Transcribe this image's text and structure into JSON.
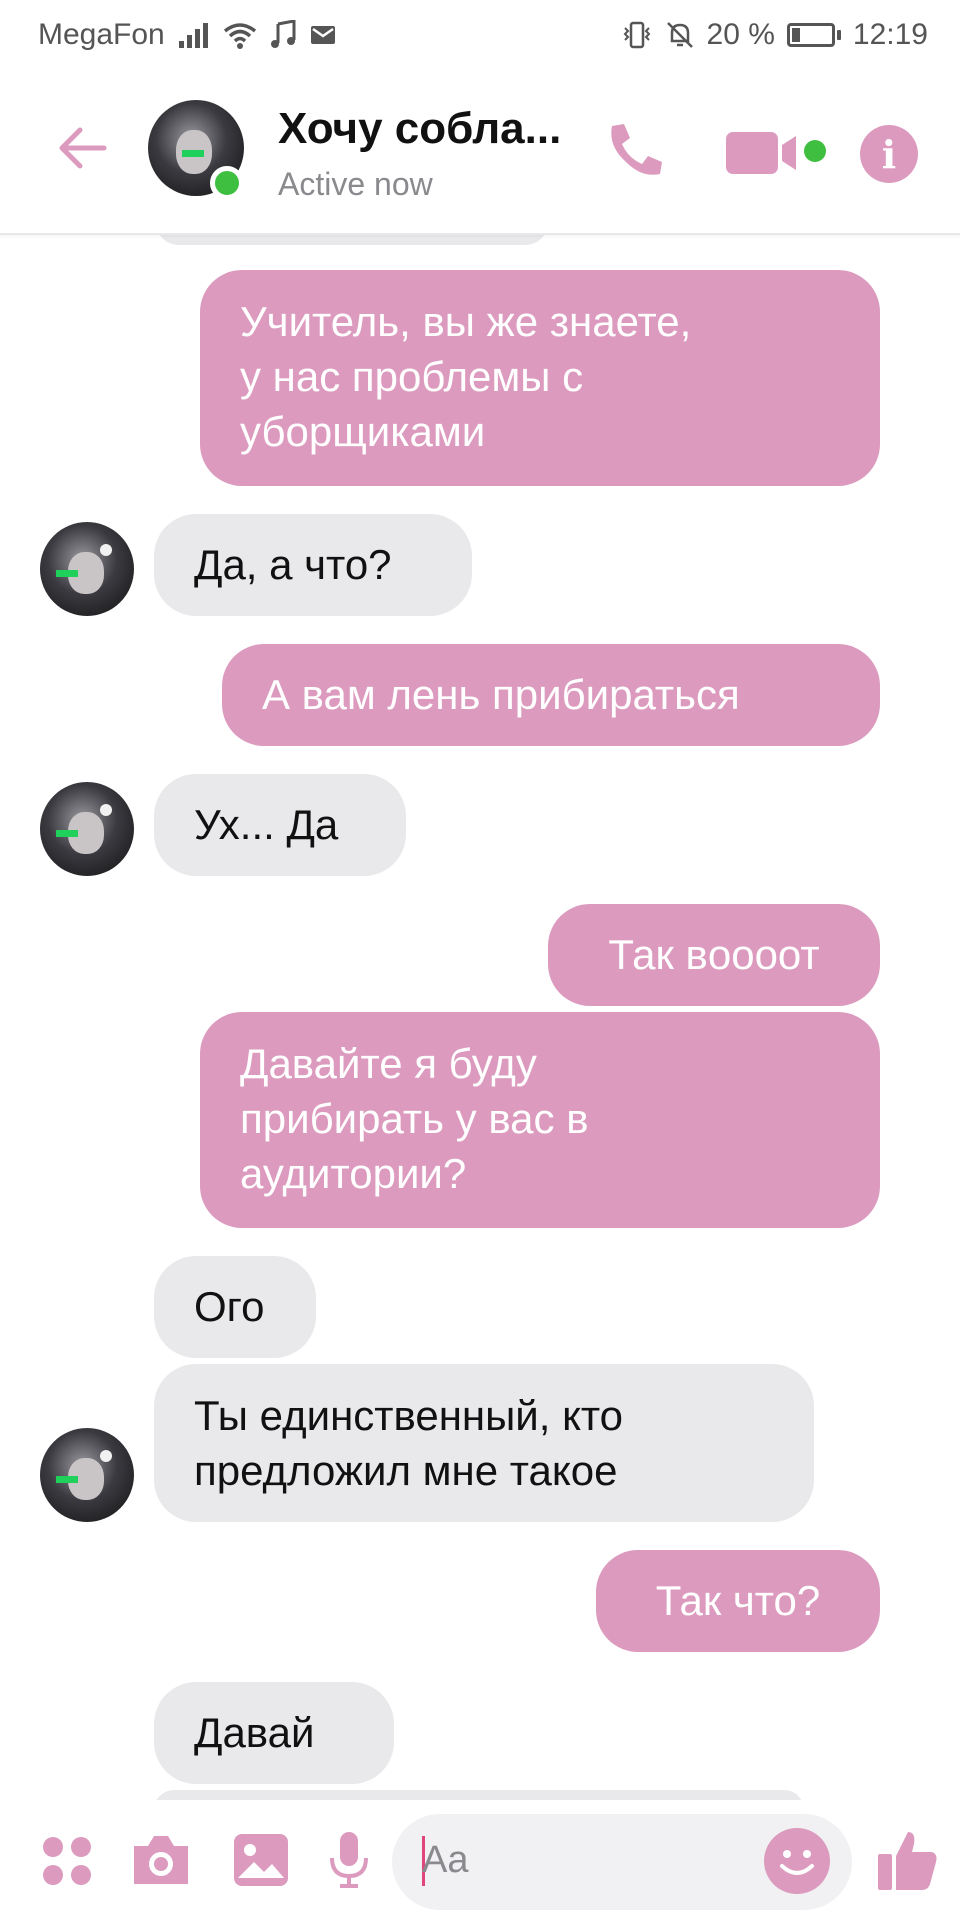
{
  "status_bar": {
    "carrier": "MegaFon",
    "battery_percent": "20 %",
    "time": "12:19",
    "icons": [
      "signal-icon",
      "wifi-icon",
      "music-icon",
      "mail-icon",
      "vibrate-icon",
      "mute-icon",
      "battery-icon"
    ]
  },
  "header": {
    "contact_name": "Хочу собла...",
    "status": "Active now",
    "icons": [
      "back-arrow-icon",
      "phone-icon",
      "video-camera-icon",
      "info-icon"
    ]
  },
  "colors": {
    "accent": "#dc9bbe",
    "incoming_bubble": "#e9e9eb",
    "online": "#3fbf3f"
  },
  "messages": [
    {
      "from": "me",
      "lines": [
        "Учитель, вы же знаете,",
        "у нас проблемы с",
        "уборщиками"
      ]
    },
    {
      "from": "them",
      "lines": [
        "Да, а что?"
      ]
    },
    {
      "from": "me",
      "lines": [
        "А вам лень прибираться"
      ]
    },
    {
      "from": "them",
      "lines": [
        "Ух... Да"
      ]
    },
    {
      "from": "me",
      "lines": [
        "Так вoooот"
      ]
    },
    {
      "from": "me",
      "lines": [
        "Давайте я буду",
        "прибирать у вас в",
        "аудитории?"
      ]
    },
    {
      "from": "them",
      "lines": [
        "Ого"
      ]
    },
    {
      "from": "them",
      "lines": [
        "Ты единственный, кто",
        "предложил мне такое"
      ]
    },
    {
      "from": "me",
      "lines": [
        "Так что?"
      ]
    },
    {
      "from": "them",
      "lines": [
        "Давай"
      ]
    }
  ],
  "composer": {
    "placeholder": "Aa",
    "icons": [
      "apps-grid-icon",
      "camera-icon",
      "gallery-icon",
      "microphone-icon",
      "emoji-icon",
      "thumbs-up-icon"
    ]
  }
}
